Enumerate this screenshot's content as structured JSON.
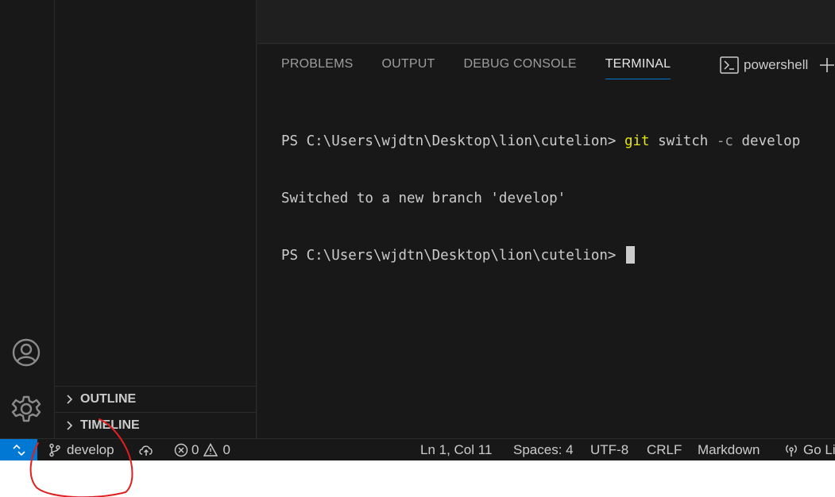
{
  "activity_bar": {
    "icons": [
      "accounts-icon",
      "gear-icon"
    ]
  },
  "sidebar": {
    "sections": [
      {
        "label": "OUTLINE",
        "icon": "chevron-right-icon"
      },
      {
        "label": "TIMELINE",
        "icon": "chevron-right-icon"
      }
    ]
  },
  "panel": {
    "tabs": [
      {
        "label": "PROBLEMS",
        "active": false
      },
      {
        "label": "OUTPUT",
        "active": false
      },
      {
        "label": "DEBUG CONSOLE",
        "active": false
      },
      {
        "label": "TERMINAL",
        "active": true
      }
    ],
    "terminal_profile": "powershell"
  },
  "terminal": {
    "line1_prompt": "PS C:\\Users\\wjdtn\\Desktop\\lion\\cutelion> ",
    "line1_cmd": "git",
    "line1_sub": " switch ",
    "line1_flag": "-c",
    "line1_arg": " develop",
    "line2": "Switched to a new branch 'develop'",
    "line3_prompt": "PS C:\\Users\\wjdtn\\Desktop\\lion\\cutelion> "
  },
  "status_bar": {
    "branch": "develop",
    "errors": "0",
    "warnings": "0",
    "cursor_position": "Ln 1, Col 11",
    "indentation": "Spaces: 4",
    "encoding": "UTF-8",
    "eol": "CRLF",
    "language": "Markdown",
    "go_live": "Go Live"
  },
  "colors": {
    "remote_bg": "#0078d4",
    "annotation": "#e02020",
    "terminal_command": "#e5e510"
  }
}
